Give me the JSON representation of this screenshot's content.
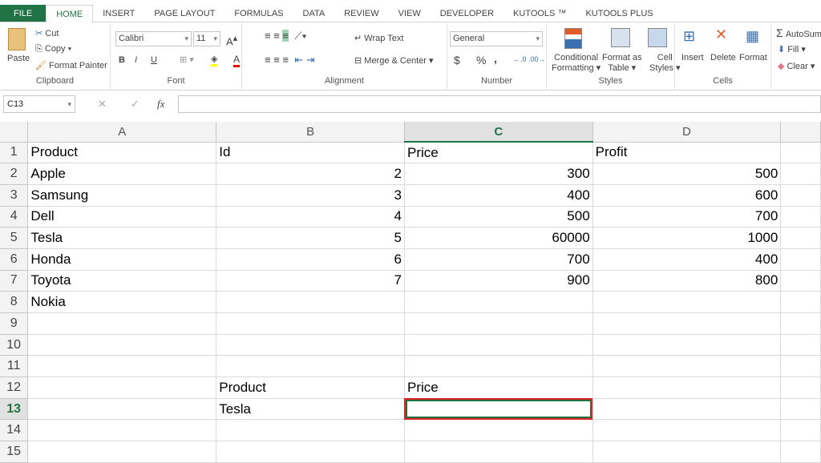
{
  "tabs": [
    "FILE",
    "HOME",
    "INSERT",
    "PAGE LAYOUT",
    "FORMULAS",
    "DATA",
    "REVIEW",
    "VIEW",
    "DEVELOPER",
    "KUTOOLS ™",
    "KUTOOLS PLUS"
  ],
  "ribbon": {
    "clipboard": {
      "label": "Clipboard",
      "paste": "Paste",
      "cut": "Cut",
      "copy": "Copy",
      "format_painter": "Format Painter"
    },
    "font": {
      "label": "Font",
      "font_name": "Calibri",
      "font_size": "11",
      "bold": "B",
      "italic": "I",
      "underline": "U"
    },
    "alignment": {
      "label": "Alignment",
      "wrap_text": "Wrap Text",
      "merge_center": "Merge & Center"
    },
    "number": {
      "label": "Number",
      "format": "General",
      "currency": "$",
      "percent": "%",
      "comma": ","
    },
    "styles": {
      "label": "Styles",
      "conditional": "Conditional",
      "conditional2": "Formatting",
      "format_table": "Format as",
      "format_table2": "Table",
      "cell_styles": "Cell",
      "cell_styles2": "Styles"
    },
    "cells": {
      "label": "Cells",
      "insert": "Insert",
      "delete": "Delete",
      "format": "Format"
    },
    "editing": {
      "autosum": "AutoSum",
      "fill": "Fill",
      "clear": "Clear"
    }
  },
  "formula_bar": {
    "name_box": "C13",
    "fx": "fx",
    "value": ""
  },
  "columns": [
    "A",
    "B",
    "C",
    "D"
  ],
  "rows": [
    [
      "Product",
      "Id",
      "Price",
      "Profit"
    ],
    [
      "Apple",
      "2",
      "300",
      "500"
    ],
    [
      "Samsung",
      "3",
      "400",
      "600"
    ],
    [
      "Dell",
      "4",
      "500",
      "700"
    ],
    [
      "Tesla",
      "5",
      "60000",
      "1000"
    ],
    [
      "Honda",
      "6",
      "700",
      "400"
    ],
    [
      "Toyota",
      "7",
      "900",
      "800"
    ],
    [
      "Nokia",
      "",
      "",
      ""
    ],
    [
      "",
      "",
      "",
      ""
    ],
    [
      "",
      "",
      "",
      ""
    ],
    [
      "",
      "",
      "",
      ""
    ],
    [
      "",
      "Product",
      "Price",
      ""
    ],
    [
      "",
      "Tesla",
      "",
      ""
    ],
    [
      "",
      "",
      "",
      ""
    ],
    [
      "",
      "",
      "",
      ""
    ]
  ]
}
